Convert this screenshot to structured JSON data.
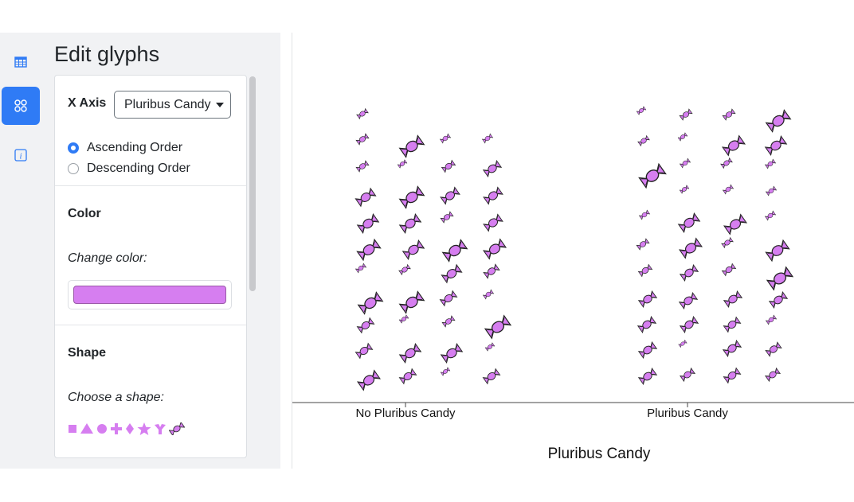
{
  "sidebar": {
    "icons": [
      {
        "name": "table-icon",
        "active": false
      },
      {
        "name": "glyphs-icon",
        "active": true
      },
      {
        "name": "info-icon",
        "active": false
      }
    ]
  },
  "panel": {
    "title": "Edit glyphs",
    "x_axis": {
      "label": "X Axis",
      "selected": "Pluribus Candy",
      "order_options": [
        {
          "label": "Ascending Order",
          "checked": true
        },
        {
          "label": "Descending Order",
          "checked": false
        }
      ]
    },
    "color": {
      "heading": "Color",
      "prompt": "Change color:",
      "value": "#d67ef0"
    },
    "shape": {
      "heading": "Shape",
      "prompt": "Choose a shape:",
      "options": [
        "square-icon",
        "triangle-icon",
        "circle-icon",
        "plus-icon",
        "diamond-icon",
        "star-icon",
        "y-shape-icon",
        "candy-icon"
      ]
    }
  },
  "colors": {
    "accent": "#2f7bf5",
    "glyph": "#d67ef0",
    "glyph_stroke": "#222222",
    "panel_bg": "#f1f2f4"
  },
  "chart_data": {
    "type": "scatter",
    "glyph": "candy",
    "xlabel": "Pluribus Candy",
    "categories": [
      "No Pluribus Candy",
      "Pluribus Candy"
    ]
  }
}
